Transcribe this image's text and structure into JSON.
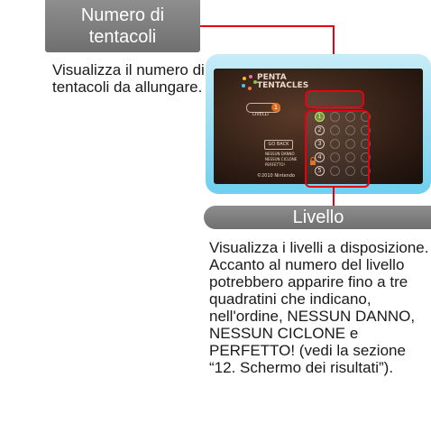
{
  "callout_top": {
    "title_line1": "Numero di",
    "title_line2": "tentacoli",
    "description": "Visualizza il numero di tentacoli da allungare."
  },
  "callout_bottom": {
    "title": "Livello",
    "description": "Visualizza i livelli a disposizione. Accanto al numero del livello potrebbero apparire fino a tre quadratini che indicano, nell'ordine, NESSUN DANNO, NESSUN CICLONE e PERFETTO! (vedi la sezione “12. Schermo dei risultati”)."
  },
  "screen": {
    "logo_line1": "PENTA",
    "logo_line2": "TENTACLES",
    "levels_label": "LIVELLI",
    "levels_badge": "1",
    "level_numbers": [
      "1",
      "2",
      "3",
      "4",
      "5"
    ],
    "back_label": "GO BACK",
    "legend": [
      "NESSUN DANNO",
      "NESSUN CICLONE",
      "PERFETTO!"
    ],
    "copyright": "©2010 Nintendo",
    "accent_color": "#e60012"
  }
}
